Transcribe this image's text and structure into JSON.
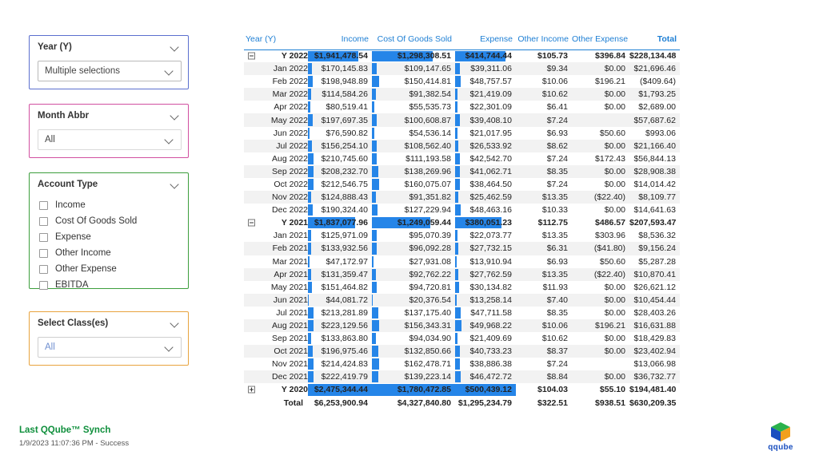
{
  "slicers": [
    {
      "name": "year",
      "title": "Year (Y)",
      "value": "Multiple selections",
      "type": "dropdown"
    },
    {
      "name": "month",
      "title": "Month Abbr",
      "value": "All",
      "type": "dropdown"
    },
    {
      "name": "account_type",
      "title": "Account Type",
      "type": "checklist",
      "options": [
        "Income",
        "Cost Of Goods Sold",
        "Expense",
        "Other Income",
        "Other Expense",
        "EBITDA"
      ]
    },
    {
      "name": "classes",
      "title": "Select Class(es)",
      "value": "All",
      "type": "dropdown"
    }
  ],
  "footer": {
    "title": "Last QQube™ Synch",
    "subtitle": "1/9/2023 11:07:36 PM - Success",
    "logo_text": "qqube"
  },
  "matrix": {
    "columns": [
      "Year (Y)",
      "Income",
      "Cost Of Goods Sold",
      "Expense",
      "Other Income",
      "Other Expense",
      "Total"
    ],
    "rows": [
      {
        "kind": "group",
        "expander": "minus",
        "label": "Y 2022",
        "cells": [
          "$1,941,478.54",
          "$1,298,308.51",
          "$414,744.44",
          "$105.73",
          "$396.84",
          "$228,134.48"
        ]
      },
      {
        "kind": "detail",
        "label": "Jan 2022",
        "cells": [
          "$170,145.83",
          "$109,147.65",
          "$39,311.06",
          "$9.34",
          "$0.00",
          "$21,696.46"
        ]
      },
      {
        "kind": "detail",
        "label": "Feb 2022",
        "cells": [
          "$198,948.89",
          "$150,414.81",
          "$48,757.57",
          "$10.06",
          "$196.21",
          "($409.64)"
        ]
      },
      {
        "kind": "detail",
        "label": "Mar 2022",
        "cells": [
          "$114,584.26",
          "$91,382.54",
          "$21,419.09",
          "$10.62",
          "$0.00",
          "$1,793.25"
        ]
      },
      {
        "kind": "detail",
        "label": "Apr 2022",
        "cells": [
          "$80,519.41",
          "$55,535.73",
          "$22,301.09",
          "$6.41",
          "$0.00",
          "$2,689.00"
        ]
      },
      {
        "kind": "detail",
        "label": "May 2022",
        "cells": [
          "$197,697.35",
          "$100,608.87",
          "$39,408.10",
          "$7.24",
          "",
          "$57,687.62"
        ]
      },
      {
        "kind": "detail",
        "label": "Jun 2022",
        "cells": [
          "$76,590.82",
          "$54,536.14",
          "$21,017.95",
          "$6.93",
          "$50.60",
          "$993.06"
        ]
      },
      {
        "kind": "detail",
        "label": "Jul 2022",
        "cells": [
          "$156,254.10",
          "$108,562.40",
          "$26,533.92",
          "$8.62",
          "$0.00",
          "$21,166.40"
        ]
      },
      {
        "kind": "detail",
        "label": "Aug 2022",
        "cells": [
          "$210,745.60",
          "$111,193.58",
          "$42,542.70",
          "$7.24",
          "$172.43",
          "$56,844.13"
        ]
      },
      {
        "kind": "detail",
        "label": "Sep 2022",
        "cells": [
          "$208,232.70",
          "$138,269.96",
          "$41,062.71",
          "$8.35",
          "$0.00",
          "$28,908.38"
        ]
      },
      {
        "kind": "detail",
        "label": "Oct 2022",
        "cells": [
          "$212,546.75",
          "$160,075.07",
          "$38,464.50",
          "$7.24",
          "$0.00",
          "$14,014.42"
        ]
      },
      {
        "kind": "detail",
        "label": "Nov 2022",
        "cells": [
          "$124,888.43",
          "$91,351.82",
          "$25,462.59",
          "$13.35",
          "($22.40)",
          "$8,109.77"
        ]
      },
      {
        "kind": "detail",
        "label": "Dec 2022",
        "cells": [
          "$190,324.40",
          "$127,229.94",
          "$48,463.16",
          "$10.33",
          "$0.00",
          "$14,641.63"
        ]
      },
      {
        "kind": "group",
        "expander": "minus",
        "label": "Y 2021",
        "cells": [
          "$1,837,077.96",
          "$1,249,059.44",
          "$380,051.23",
          "$112.75",
          "$486.57",
          "$207,593.47"
        ]
      },
      {
        "kind": "detail",
        "label": "Jan 2021",
        "cells": [
          "$125,971.09",
          "$95,070.39",
          "$22,073.77",
          "$13.35",
          "$303.96",
          "$8,536.32"
        ]
      },
      {
        "kind": "detail",
        "label": "Feb 2021",
        "cells": [
          "$133,932.56",
          "$96,092.28",
          "$27,732.15",
          "$6.31",
          "($41.80)",
          "$9,156.24"
        ]
      },
      {
        "kind": "detail",
        "label": "Mar 2021",
        "cells": [
          "$47,172.97",
          "$27,931.08",
          "$13,910.94",
          "$6.93",
          "$50.60",
          "$5,287.28"
        ]
      },
      {
        "kind": "detail",
        "label": "Apr 2021",
        "cells": [
          "$131,359.47",
          "$92,762.22",
          "$27,762.59",
          "$13.35",
          "($22.40)",
          "$10,870.41"
        ]
      },
      {
        "kind": "detail",
        "label": "May 2021",
        "cells": [
          "$151,464.82",
          "$94,720.81",
          "$30,134.82",
          "$11.93",
          "$0.00",
          "$26,621.12"
        ]
      },
      {
        "kind": "detail",
        "label": "Jun 2021",
        "cells": [
          "$44,081.72",
          "$20,376.54",
          "$13,258.14",
          "$7.40",
          "$0.00",
          "$10,454.44"
        ]
      },
      {
        "kind": "detail",
        "label": "Jul 2021",
        "cells": [
          "$213,281.89",
          "$137,175.40",
          "$47,711.58",
          "$8.35",
          "$0.00",
          "$28,403.26"
        ]
      },
      {
        "kind": "detail",
        "label": "Aug 2021",
        "cells": [
          "$223,129.56",
          "$156,343.31",
          "$49,968.22",
          "$10.06",
          "$196.21",
          "$16,631.88"
        ]
      },
      {
        "kind": "detail",
        "label": "Sep 2021",
        "cells": [
          "$133,863.80",
          "$94,034.90",
          "$21,409.69",
          "$10.62",
          "$0.00",
          "$18,429.83"
        ]
      },
      {
        "kind": "detail",
        "label": "Oct 2021",
        "cells": [
          "$196,975.46",
          "$132,850.66",
          "$40,733.23",
          "$8.37",
          "$0.00",
          "$23,402.94"
        ]
      },
      {
        "kind": "detail",
        "label": "Nov 2021",
        "cells": [
          "$214,424.83",
          "$162,478.71",
          "$38,886.38",
          "$7.24",
          "",
          "$13,066.98"
        ]
      },
      {
        "kind": "detail",
        "label": "Dec 2021",
        "cells": [
          "$222,419.79",
          "$139,223.14",
          "$46,472.72",
          "$8.84",
          "$0.00",
          "$36,732.77"
        ]
      },
      {
        "kind": "group",
        "expander": "plus",
        "label": "Y 2020",
        "cells": [
          "$2,475,344.44",
          "$1,780,472.85",
          "$500,439.12",
          "$104.03",
          "$55.10",
          "$194,481.40"
        ]
      },
      {
        "kind": "total",
        "label": "Total",
        "cells": [
          "$6,253,900.94",
          "$4,327,840.80",
          "$1,295,234.79",
          "$322.51",
          "$938.51",
          "$630,209.35"
        ]
      }
    ],
    "bar_color": "#2585E8",
    "bar_max": {
      "income": 2475344.44,
      "cogs": 1780472.85,
      "expense": 500439.12
    },
    "bar_values": [
      [
        1941478.54,
        1298308.51,
        414744.44
      ],
      [
        170145.83,
        109147.65,
        39311.06
      ],
      [
        198948.89,
        150414.81,
        48757.57
      ],
      [
        114584.26,
        91382.54,
        21419.09
      ],
      [
        80519.41,
        55535.73,
        22301.09
      ],
      [
        197697.35,
        100608.87,
        39408.1
      ],
      [
        76590.82,
        54536.14,
        21017.95
      ],
      [
        156254.1,
        108562.4,
        26533.92
      ],
      [
        210745.6,
        111193.58,
        42542.7
      ],
      [
        208232.7,
        138269.96,
        41062.71
      ],
      [
        212546.75,
        160075.07,
        38464.5
      ],
      [
        124888.43,
        91351.82,
        25462.59
      ],
      [
        190324.4,
        127229.94,
        48463.16
      ],
      [
        1837077.96,
        1249059.44,
        380051.23
      ],
      [
        125971.09,
        95070.39,
        22073.77
      ],
      [
        133932.56,
        96092.28,
        27732.15
      ],
      [
        47172.97,
        27931.08,
        13910.94
      ],
      [
        131359.47,
        92762.22,
        27762.59
      ],
      [
        151464.82,
        94720.81,
        30134.82
      ],
      [
        44081.72,
        20376.54,
        13258.14
      ],
      [
        213281.89,
        137175.4,
        47711.58
      ],
      [
        223129.56,
        156343.31,
        49968.22
      ],
      [
        133863.8,
        94034.9,
        21409.69
      ],
      [
        196975.46,
        132850.66,
        40733.23
      ],
      [
        214424.83,
        162478.71,
        38886.38
      ],
      [
        222419.79,
        139223.14,
        46472.72
      ],
      [
        2475344.44,
        1780472.85,
        500439.12
      ],
      [
        0,
        0,
        0
      ]
    ]
  }
}
